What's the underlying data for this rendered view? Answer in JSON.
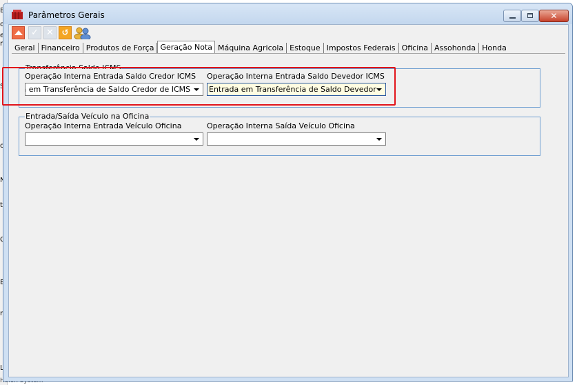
{
  "background": {
    "edge_chars": [
      "B",
      "o",
      "er",
      "ra",
      "S",
      "o",
      "N",
      "ta",
      "C",
      "E",
      "ra",
      "L"
    ],
    "footer_text": "Holon System"
  },
  "window": {
    "title": "Parâmetros Gerais",
    "close_glyph": "✕"
  },
  "toolbar": {
    "check_glyph": "✓",
    "cancel_glyph": "✕",
    "refresh_glyph": "↺"
  },
  "tabs": [
    {
      "label": "Geral"
    },
    {
      "label": "Financeiro"
    },
    {
      "label": "Produtos de Força"
    },
    {
      "label": "Geração Nota"
    },
    {
      "label": "Máquina Agricola"
    },
    {
      "label": "Estoque"
    },
    {
      "label": "Impostos Federais"
    },
    {
      "label": "Oficina"
    },
    {
      "label": "Assohonda"
    },
    {
      "label": "Honda"
    }
  ],
  "active_tab": "Geração Nota",
  "group_icms": {
    "title": "Transferência Saldo ICMS",
    "credor_label": "Operação Interna Entrada Saldo Credor ICMS",
    "credor_value": "Entrada em Transferência de Saldo Credor de ICMS",
    "devedor_label": "Operação Interna Entrada Saldo Devedor ICMS",
    "devedor_value": "Entrada em Transferência de Saldo Devedor"
  },
  "group_oficina": {
    "title": "Entrada/Saída Veículo na Oficina",
    "entrada_label": "Operação Interna Entrada Veículo Oficina",
    "entrada_value": "",
    "saida_label": "Operação Interna Saída Veículo Oficina",
    "saida_value": ""
  },
  "colors": {
    "highlight": "#e2141a",
    "group_border": "#6e9ed1",
    "close_button": "#c8432c"
  }
}
